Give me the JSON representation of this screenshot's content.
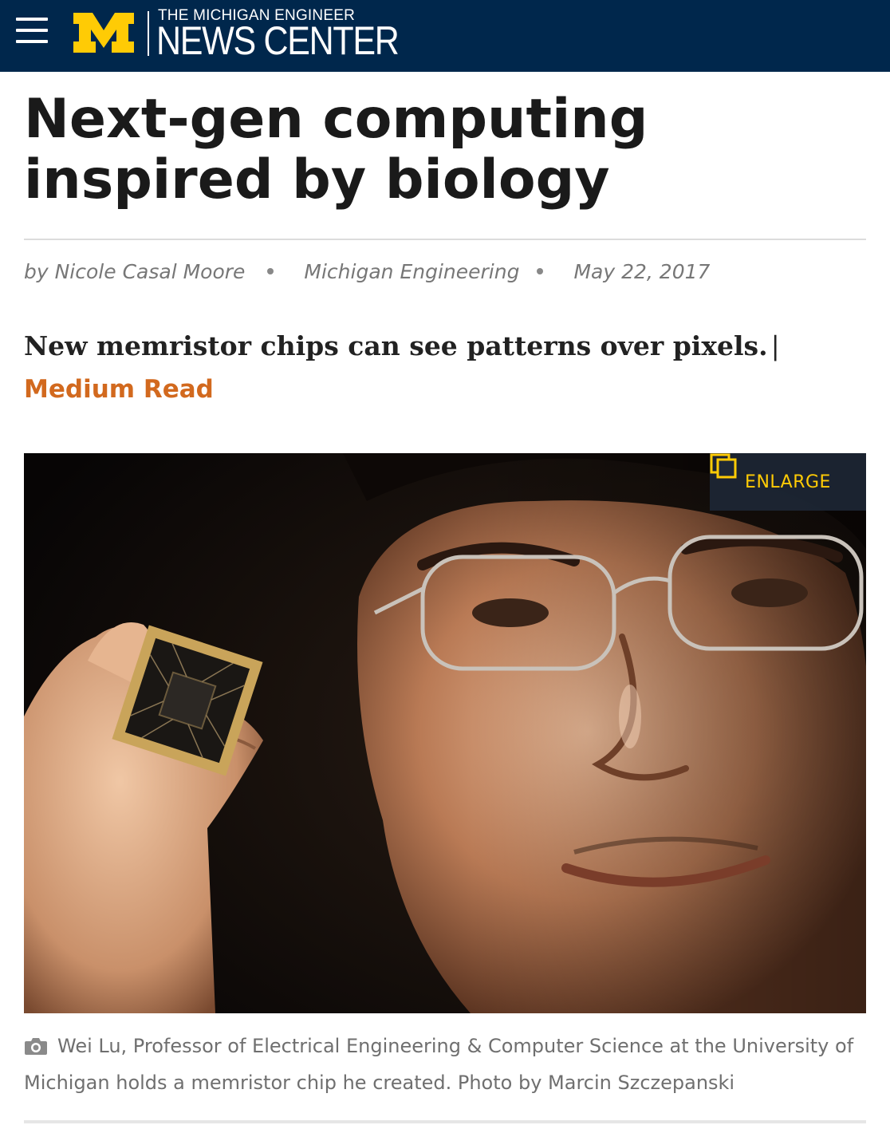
{
  "header": {
    "brand_top": "THE MICHIGAN ENGINEER",
    "brand_main": "NEWS CENTER",
    "menu_icon": "hamburger-menu-icon",
    "logo": "block-m-logo",
    "colors": {
      "navy": "#00274c",
      "maize": "#ffcb05"
    }
  },
  "article": {
    "title": "Next-gen computing inspired by biology",
    "byline": {
      "author": "by Nicole Casal Moore",
      "source": "Michigan Engineering",
      "date": "May 22, 2017"
    },
    "subtitle": "New memristor chips can see patterns over pixels.",
    "subtitle_separator": "|",
    "read_time": "Medium Read",
    "accent_color": "#d2691e",
    "image": {
      "enlarge_label": "ENLARGE",
      "enlarge_icon": "enlarge-icon",
      "caption_icon": "camera-icon",
      "caption": "Wei Lu, Professor of Electrical Engineering & Computer Science at the University of Michigan holds a memristor chip he created. Photo by Marcin Szczepanski"
    }
  }
}
